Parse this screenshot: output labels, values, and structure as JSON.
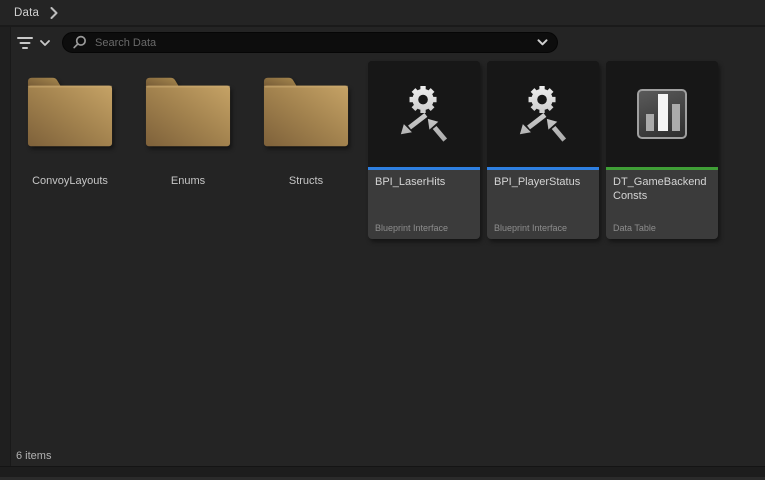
{
  "breadcrumb": {
    "current": "Data"
  },
  "toolbar": {
    "search_placeholder": "Search Data",
    "search_value": ""
  },
  "grid": {
    "items": [
      {
        "kind": "folder",
        "label": "ConvoyLayouts",
        "icon": "folder-icon"
      },
      {
        "kind": "folder",
        "label": "Enums",
        "icon": "folder-icon"
      },
      {
        "kind": "folder",
        "label": "Structs",
        "icon": "folder-icon"
      },
      {
        "kind": "asset",
        "label": "BPI_LaserHits",
        "asset_type": "Blueprint Interface",
        "icon": "blueprint-interface-icon",
        "accent_color": "#2e7fe0"
      },
      {
        "kind": "asset",
        "label": "BPI_PlayerStatus",
        "asset_type": "Blueprint Interface",
        "icon": "blueprint-interface-icon",
        "accent_color": "#2e7fe0"
      },
      {
        "kind": "asset",
        "label": "DT_GameBackendConsts",
        "asset_type": "Data Table",
        "icon": "data-table-icon",
        "accent_color": "#3f9e36"
      }
    ]
  },
  "status_bar": {
    "items_count": "6 items"
  },
  "colors": {
    "background": "#242424",
    "thumbnail_bg": "#171717",
    "tile_name_bg": "#3b3b3b",
    "blueprint_interface_accent": "#2e7fe0",
    "data_table_accent": "#3f9e36",
    "folder_light": "#c3a065",
    "folder_dark": "#84663a"
  }
}
